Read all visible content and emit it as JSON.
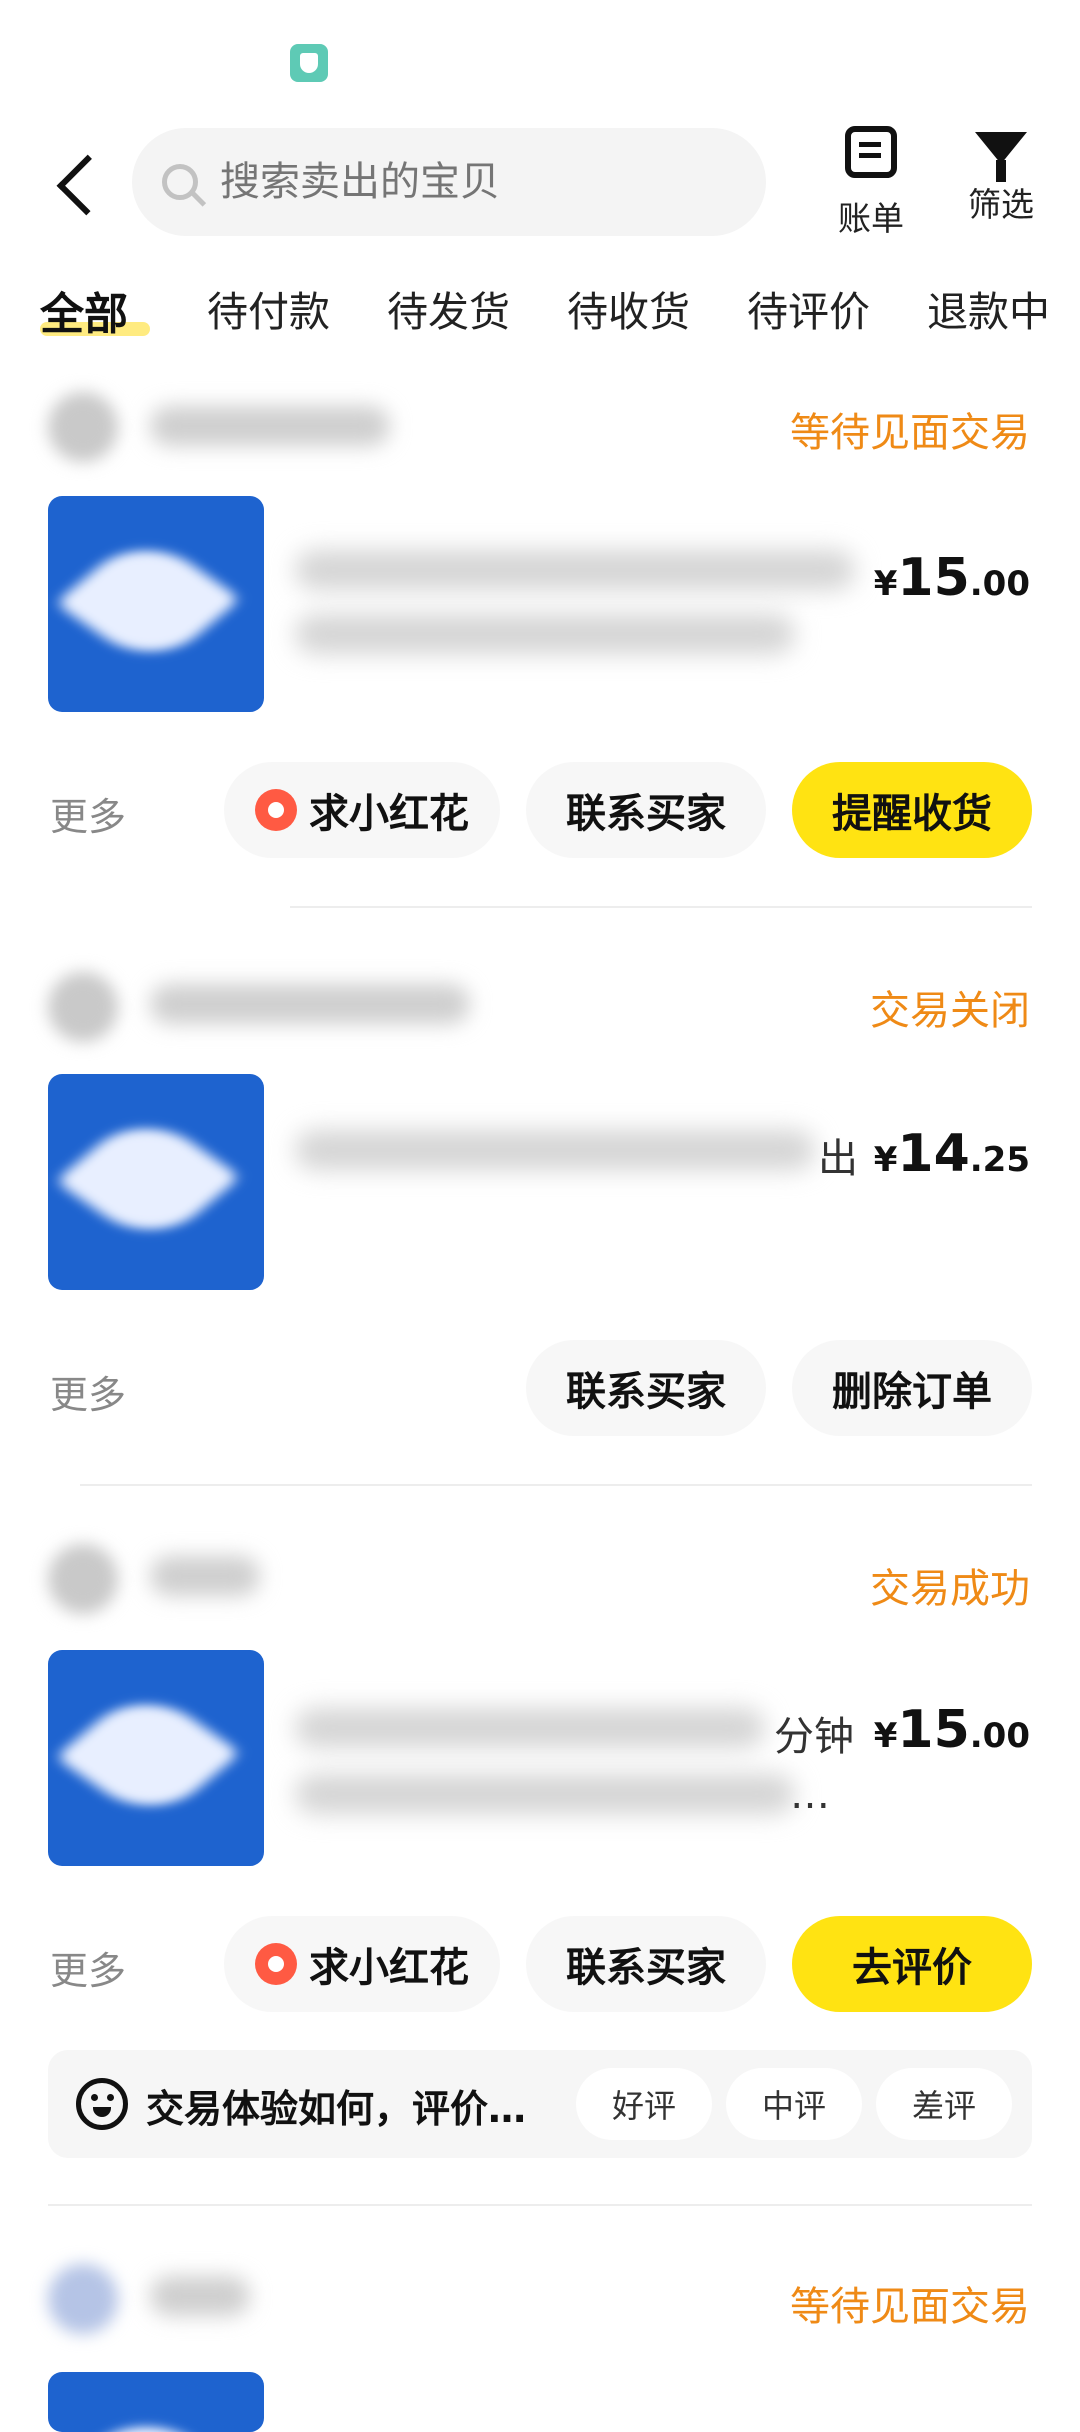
{
  "search": {
    "placeholder": "搜索卖出的宝贝"
  },
  "header": {
    "bill_label": "账单",
    "filter_label": "筛选"
  },
  "tabs": [
    "全部",
    "待付款",
    "待发货",
    "待收货",
    "待评价",
    "退款中"
  ],
  "orders": [
    {
      "status": "等待见面交易",
      "price": {
        "currency": "¥",
        "int": "15",
        "dec": ".00"
      },
      "more": "更多",
      "btn_flower": "求小红花",
      "btn_contact": "联系买家",
      "btn_primary": "提醒收货"
    },
    {
      "status": "交易关闭",
      "title_tail": "出",
      "price": {
        "currency": "¥",
        "int": "14",
        "dec": ".25"
      },
      "more": "更多",
      "btn_contact": "联系买家",
      "btn_delete": "删除订单"
    },
    {
      "status": "交易成功",
      "title_tail": "分钟",
      "title_tail2": "…",
      "price": {
        "currency": "¥",
        "int": "15",
        "dec": ".00"
      },
      "more": "更多",
      "btn_flower": "求小红花",
      "btn_contact": "联系买家",
      "btn_primary": "去评价",
      "review": {
        "prompt": "交易体验如何，评价…",
        "good": "好评",
        "mid": "中评",
        "bad": "差评"
      }
    },
    {
      "status": "等待见面交易"
    }
  ]
}
